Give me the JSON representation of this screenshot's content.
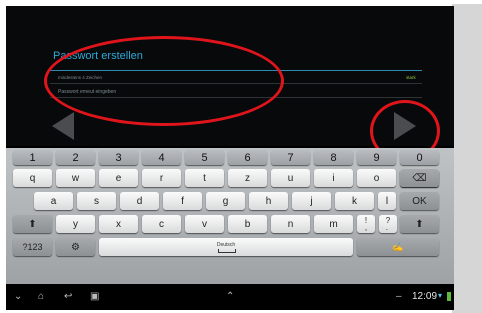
{
  "screen": {
    "title": "Passwort erstellen",
    "field1_hint": "mindestens 4 Zeichen",
    "strength_label": "stark",
    "field2_placeholder": "Passwort erneut eingeben"
  },
  "keyboard": {
    "row1": [
      "1",
      "2",
      "3",
      "4",
      "5",
      "6",
      "7",
      "8",
      "9",
      "0"
    ],
    "row2": [
      "q",
      "w",
      "e",
      "r",
      "t",
      "z",
      "u",
      "i",
      "o",
      "p"
    ],
    "row3": [
      "a",
      "s",
      "d",
      "f",
      "g",
      "h",
      "j",
      "k",
      "l"
    ],
    "row3_ok": "OK",
    "row4": [
      "y",
      "x",
      "c",
      "v",
      "b",
      "n",
      "m"
    ],
    "row4_punct": [
      "!\n,",
      "?\n."
    ],
    "sym_label": "?123",
    "space_label": "Deutsch"
  },
  "statusbar": {
    "time": "12:09"
  },
  "colors": {
    "accent": "#2ea8d6",
    "annotation": "#e0151c"
  }
}
